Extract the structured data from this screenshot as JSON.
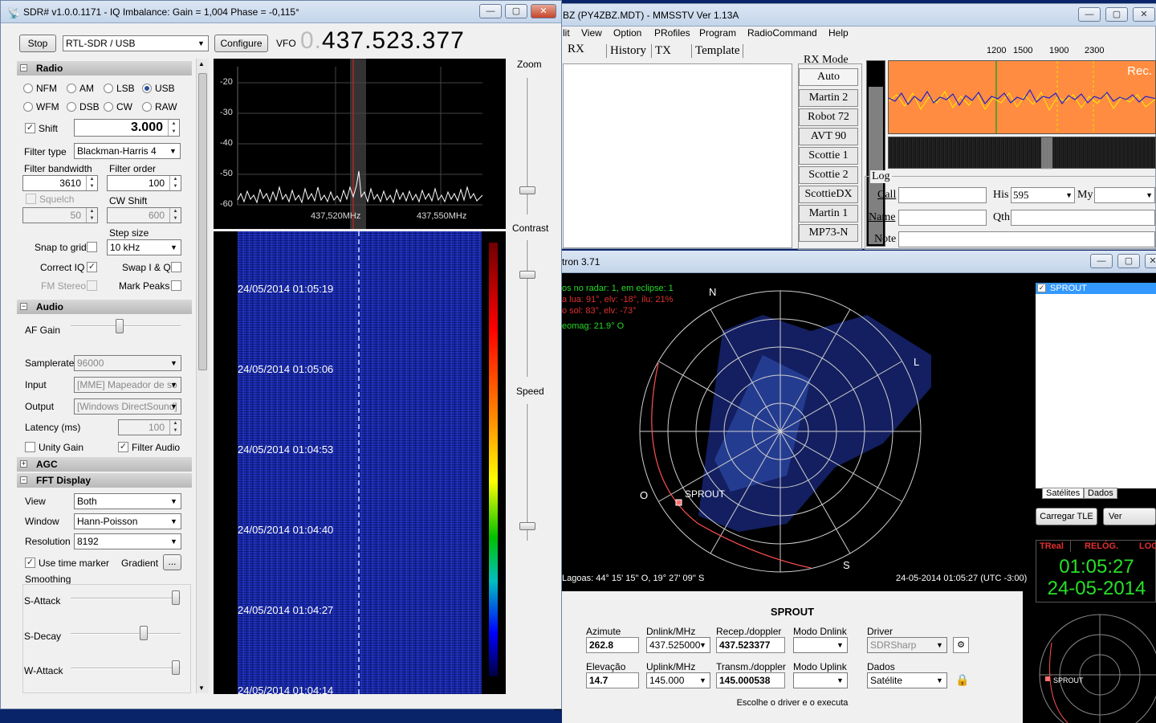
{
  "sdr": {
    "title": "SDR# v1.0.0.1171 - IQ Imbalance: Gain = 1,004 Phase = -0,115°",
    "stop": "Stop",
    "source": "RTL-SDR / USB",
    "configure": "Configure",
    "vfo_label": "VFO",
    "vfo_lead": "0.",
    "vfo_value": "437.523.377",
    "radio_section": "Radio",
    "modes": [
      "NFM",
      "AM",
      "LSB",
      "USB",
      "WFM",
      "DSB",
      "CW",
      "RAW"
    ],
    "selected_mode": "USB",
    "shift_label": "Shift",
    "shift_value": "3.000",
    "filter_type_label": "Filter type",
    "filter_type": "Blackman-Harris 4",
    "filter_bw_label": "Filter bandwidth",
    "filter_bw": "3610",
    "filter_order_label": "Filter order",
    "filter_order": "100",
    "squelch_label": "Squelch",
    "squelch_value": "50",
    "cw_shift_label": "CW Shift",
    "cw_shift": "600",
    "step_size_label": "Step size",
    "snap_label": "Snap to grid",
    "step_size": "10 kHz",
    "correct_iq": "Correct IQ",
    "swap_iq": "Swap I & Q",
    "fm_stereo": "FM Stereo",
    "mark_peaks": "Mark Peaks",
    "audio_section": "Audio",
    "af_gain": "AF Gain",
    "samplerate_label": "Samplerate",
    "samplerate": "96000",
    "input_label": "Input",
    "input": "[MME] Mapeador de so",
    "output_label": "Output",
    "output": "[Windows DirectSound]",
    "latency_label": "Latency (ms)",
    "latency": "100",
    "unity_gain": "Unity Gain",
    "filter_audio": "Filter Audio",
    "agc_section": "AGC",
    "fft_section": "FFT Display",
    "view_label": "View",
    "view": "Both",
    "window_label": "Window",
    "window": "Hann-Poisson",
    "resolution_label": "Resolution",
    "resolution": "8192",
    "time_marker": "Use time marker",
    "gradient_label": "Gradient",
    "gradient_btn": "...",
    "smoothing": "Smoothing",
    "s_attack": "S-Attack",
    "s_decay": "S-Decay",
    "w_attack": "W-Attack",
    "zoom": "Zoom",
    "contrast": "Contrast",
    "speed": "Speed",
    "db_ticks": [
      "-20",
      "-30",
      "-40",
      "-50",
      "-60"
    ],
    "freq_ticks": [
      "437,520MHz",
      "437,550MHz"
    ],
    "timestamps": [
      "24/05/2014 01:05:19",
      "24/05/2014 01:05:06",
      "24/05/2014 01:04:53",
      "24/05/2014 01:04:40",
      "24/05/2014 01:04:27",
      "24/05/2014 01:04:14"
    ]
  },
  "mmsstv": {
    "title": "BZ (PY4ZBZ.MDT) - MMSSTV Ver 1.13A",
    "menu": [
      "lit",
      "View",
      "Option",
      "PRofiles",
      "Program",
      "RadioCommand",
      "Help"
    ],
    "tabs": [
      "RX",
      "History",
      "TX",
      "Template"
    ],
    "rx_mode_label": "RX Mode",
    "modes": [
      "Auto",
      "Martin 2",
      "Robot 72",
      "AVT 90",
      "Scottie 1",
      "Scottie 2",
      "ScottieDX",
      "Martin 1",
      "MP73-N"
    ],
    "freq_ticks": [
      "1200",
      "1500",
      "1900",
      "2300"
    ],
    "rec": "Rec.",
    "log_label": "Log",
    "call": "Call",
    "his": "His",
    "his_value": "595",
    "my": "My",
    "name": "Name",
    "qth": "Qth",
    "note": "Note"
  },
  "orbitron": {
    "title": "tron 3.71",
    "info": [
      "os no radar: 1, em eclipse: 1",
      "a lua: 91°, elv: -18°, ilu: 21%",
      "o sol: 83°, elv: -73°",
      "eomag: 21.9° O"
    ],
    "compass": {
      "n": "N",
      "l": "L",
      "s": "S",
      "o": "O"
    },
    "sat_label": "SPROUT",
    "location": "Lagoas: 44° 15' 15'' O, 19° 27' 09'' S",
    "datetime": "24-05-2014 01:05:27 (UTC -3:00)",
    "list_item": "SPROUT",
    "tab_sat": "Satélites",
    "tab_dados": "Dados",
    "btn_tle": "Carregar TLE",
    "btn_next": "Ver Próximo",
    "clock_tabs": [
      "TReal",
      "RELÓG.",
      "LOC"
    ],
    "clock_time": "01:05:27",
    "clock_date": "24-05-2014",
    "mini_label": "SPROUT",
    "panel_title": "SPROUT",
    "azimute_label": "Azimute",
    "azimute": "262.8",
    "dnlink_label": "Dnlink/MHz",
    "dnlink": "437.525000",
    "recep_label": "Recep./doppler",
    "recep": "437.523377",
    "modo_dn_label": "Modo Dnlink",
    "driver_label": "Driver",
    "driver": "SDRSharp",
    "elev_label": "Elevação",
    "elev": "14.7",
    "uplink_label": "Uplink/MHz",
    "uplink": "145.000",
    "transm_label": "Transm./doppler",
    "transm": "145.000538",
    "modo_up_label": "Modo Uplink",
    "dados_label": "Dados",
    "dados": "Satélite",
    "hint": "Escolhe o driver e o executa"
  }
}
